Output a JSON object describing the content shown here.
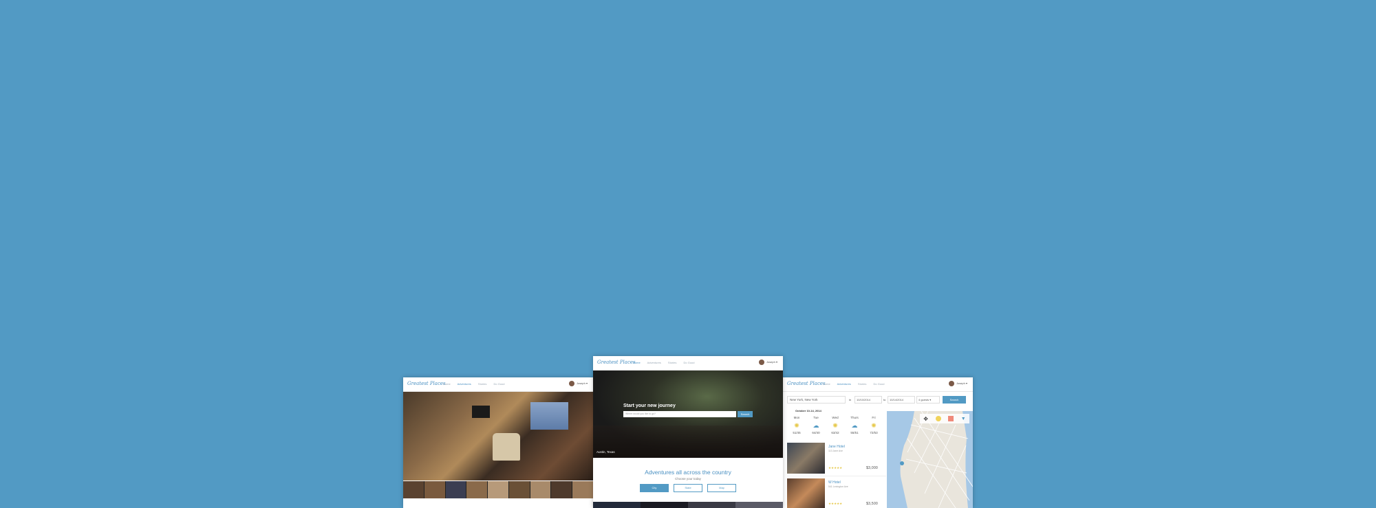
{
  "brand": {
    "logo": "Greatest Places",
    "accent": "#529ac4",
    "background": "#529ac4"
  },
  "nav": {
    "links": [
      "Home",
      "Adventures",
      "Stories",
      "Do Good"
    ],
    "user": "Joseph ▾"
  },
  "center": {
    "hero_title": "Start your new journey",
    "search_placeholder": "Where would you like to go?",
    "search_button": "Search",
    "location": "Austin, Texas",
    "section_title": "Adventures all across the country",
    "section_subtitle": "Choose your today",
    "tabs": [
      "City",
      "State",
      "Map"
    ]
  },
  "right": {
    "destination": "New York, New York",
    "from_label": "in",
    "from_date": "10/10/2014",
    "to_label": "to",
    "to_date": "10/14/2014",
    "guests": "4 guests ▾",
    "search_button": "Search",
    "forecast_title": "October 10-14, 2014",
    "forecast": [
      {
        "day": "Mon",
        "icon": "sun-icon",
        "temps": "51/45"
      },
      {
        "day": "Tue",
        "icon": "cloud-icon",
        "temps": "64/40"
      },
      {
        "day": "Wed",
        "icon": "sun-icon",
        "temps": "63/42"
      },
      {
        "day": "Thurs",
        "icon": "cloud-icon",
        "temps": "55/51"
      },
      {
        "day": "Fri",
        "icon": "sun-icon",
        "temps": "72/53"
      }
    ],
    "hotels": [
      {
        "name": "Jane Hotel",
        "address": "113 Jane Ave",
        "price": "$3,000",
        "stars": "★★★★★"
      },
      {
        "name": "W Hotel",
        "address": "541 Lexington Ave",
        "price": "$3,500",
        "stars": "★★★★★"
      }
    ]
  }
}
